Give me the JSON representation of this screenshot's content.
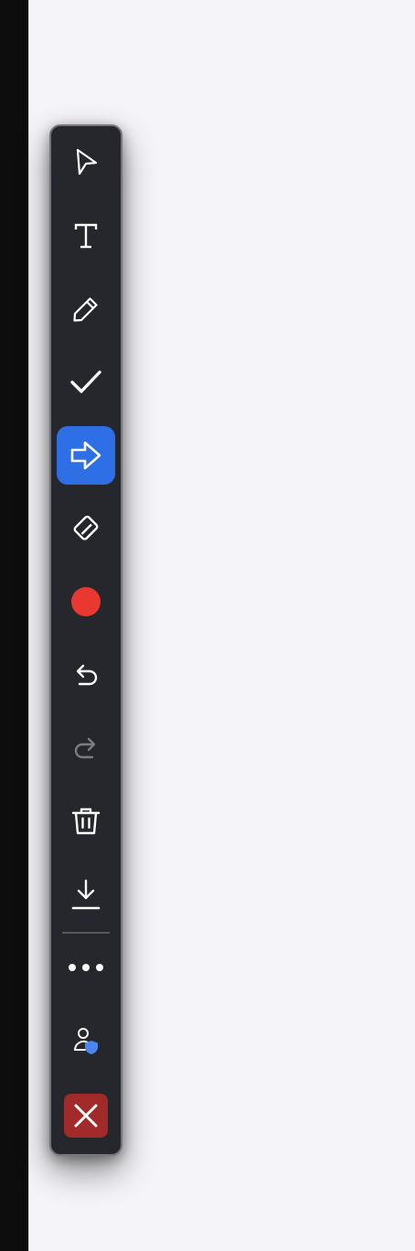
{
  "toolbar": {
    "tools": [
      {
        "name": "select",
        "icon": "pointer-icon",
        "active": false,
        "enabled": true
      },
      {
        "name": "text",
        "icon": "text-icon",
        "active": false,
        "enabled": true
      },
      {
        "name": "pen",
        "icon": "pencil-icon",
        "active": false,
        "enabled": true
      },
      {
        "name": "checkmark",
        "icon": "checkmark-icon",
        "active": false,
        "enabled": true
      },
      {
        "name": "arrow",
        "icon": "arrow-right-icon",
        "active": true,
        "enabled": true
      },
      {
        "name": "eraser",
        "icon": "eraser-icon",
        "active": false,
        "enabled": true
      },
      {
        "name": "color",
        "icon": "color-swatch-icon",
        "active": false,
        "enabled": true
      },
      {
        "name": "undo",
        "icon": "undo-icon",
        "active": false,
        "enabled": true
      },
      {
        "name": "redo",
        "icon": "redo-icon",
        "active": false,
        "enabled": false
      },
      {
        "name": "delete",
        "icon": "trash-icon",
        "active": false,
        "enabled": true
      },
      {
        "name": "save",
        "icon": "download-icon",
        "active": false,
        "enabled": true
      },
      {
        "name": "more",
        "icon": "more-icon",
        "active": false,
        "enabled": true
      },
      {
        "name": "privacy",
        "icon": "user-shield-icon",
        "active": false,
        "enabled": true
      },
      {
        "name": "close",
        "icon": "close-icon",
        "active": false,
        "enabled": true
      }
    ],
    "colors": {
      "background": "#26272c",
      "active": "#2f6fe6",
      "selected_color": "#e8382f",
      "close_button": "#a32a2a",
      "shield_accent": "#4b86f0",
      "disabled_icon": "#7c7d82"
    }
  }
}
